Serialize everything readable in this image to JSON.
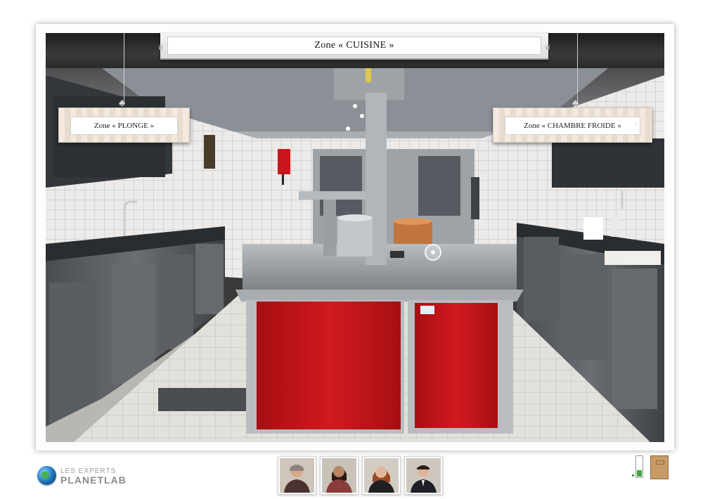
{
  "title": {
    "label": "Zone « CUISINE »"
  },
  "zones": {
    "left": {
      "label": "Zone « PLONGE »"
    },
    "right": {
      "label": "Zone « CHAMBRE FROIDE »"
    }
  },
  "logo": {
    "line1": "LES EXPERTS",
    "line2": "PLANETLAB"
  },
  "experts": [
    {
      "icon": "expert-avatar-1"
    },
    {
      "icon": "expert-avatar-2"
    },
    {
      "icon": "expert-avatar-3"
    },
    {
      "icon": "expert-avatar-4"
    }
  ],
  "volume": {
    "level": 0.3,
    "icon": "volume-meter-icon"
  },
  "exit": {
    "icon": "door-exit-icon"
  },
  "colors": {
    "island_red": "#c8161c",
    "steel": "#9aa0a6"
  }
}
